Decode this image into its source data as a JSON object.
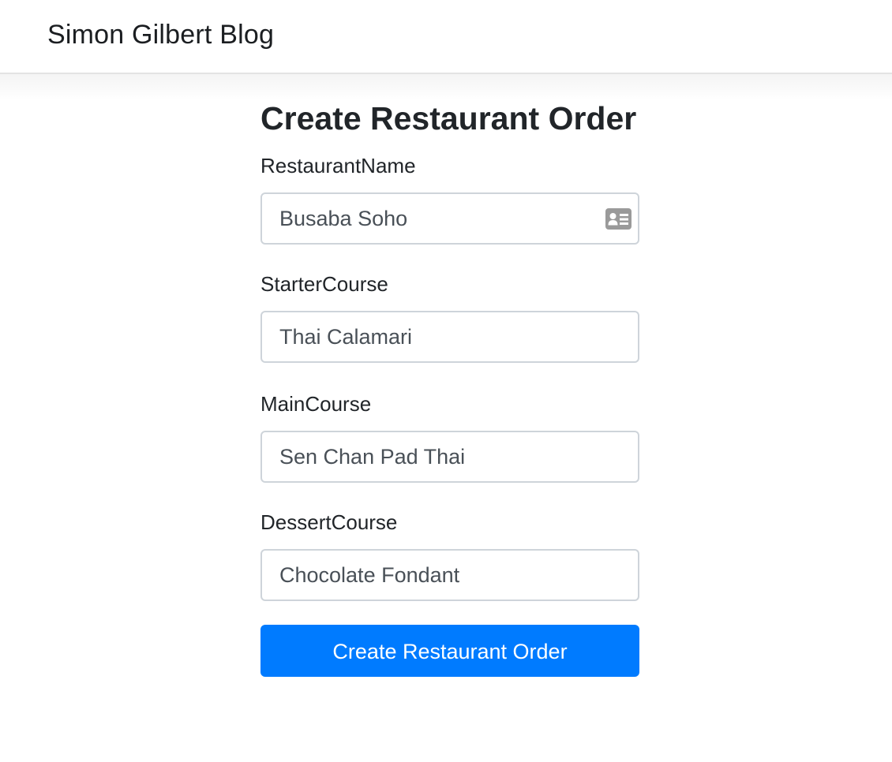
{
  "navbar": {
    "brand": "Simon Gilbert Blog"
  },
  "form": {
    "title": "Create Restaurant Order",
    "fields": [
      {
        "label": "RestaurantName",
        "value": "Busaba Soho",
        "icon": "contact-card-icon"
      },
      {
        "label": "StarterCourse",
        "value": "Thai Calamari"
      },
      {
        "label": "MainCourse",
        "value": "Sen Chan Pad Thai"
      },
      {
        "label": "DessertCourse",
        "value": "Chocolate Fondant"
      }
    ],
    "submit_label": "Create Restaurant Order"
  },
  "colors": {
    "primary": "#007bff",
    "input_border": "#ced4da",
    "input_text": "#495057",
    "icon_gray": "#9a9a9a"
  }
}
